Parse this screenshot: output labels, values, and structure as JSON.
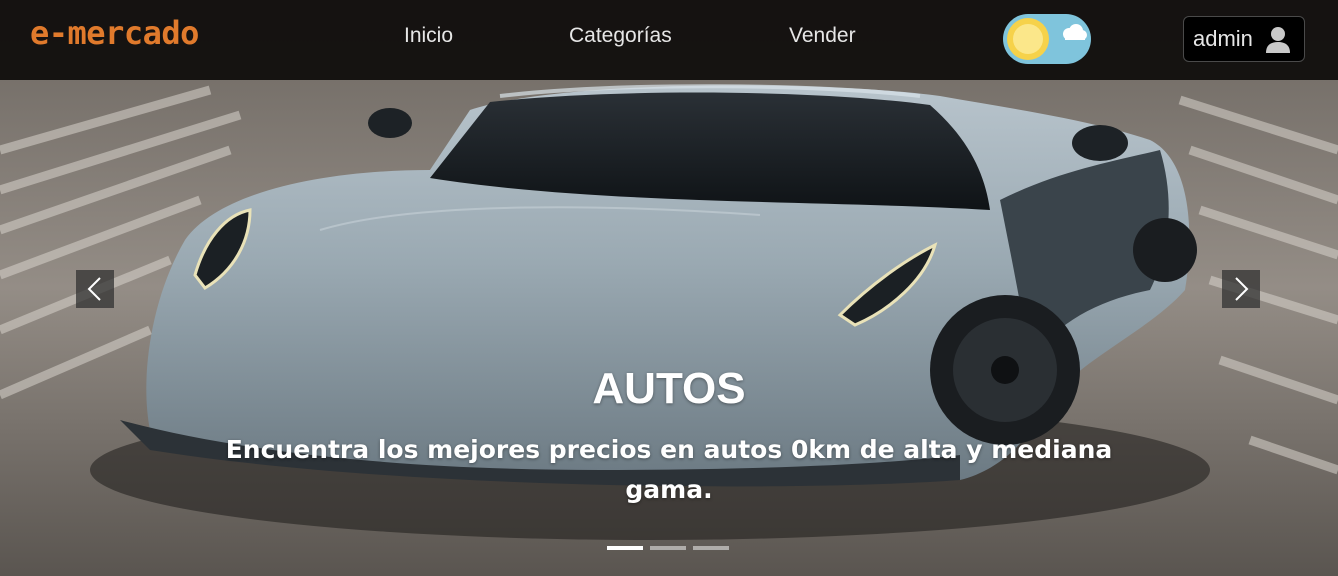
{
  "brand": {
    "name": "e-mercado",
    "color": "#e07a2c"
  },
  "nav": {
    "links": [
      {
        "label": "Inicio"
      },
      {
        "label": "Categorías"
      },
      {
        "label": "Vender"
      }
    ]
  },
  "theme_toggle": {
    "mode": "light",
    "icons": [
      "sun-icon",
      "cloud-icon"
    ],
    "color": "#7fc4dc"
  },
  "user": {
    "label": "admin",
    "icon": "user-icon"
  },
  "carousel": {
    "slide_title": "AUTOS",
    "slide_text": "Encuentra los mejores precios en autos 0km de alta y mediana gama.",
    "image": "grey-sports-car",
    "indicators": 3,
    "active_index": 0,
    "prev_icon": "chevron-left-icon",
    "next_icon": "chevron-right-icon"
  }
}
